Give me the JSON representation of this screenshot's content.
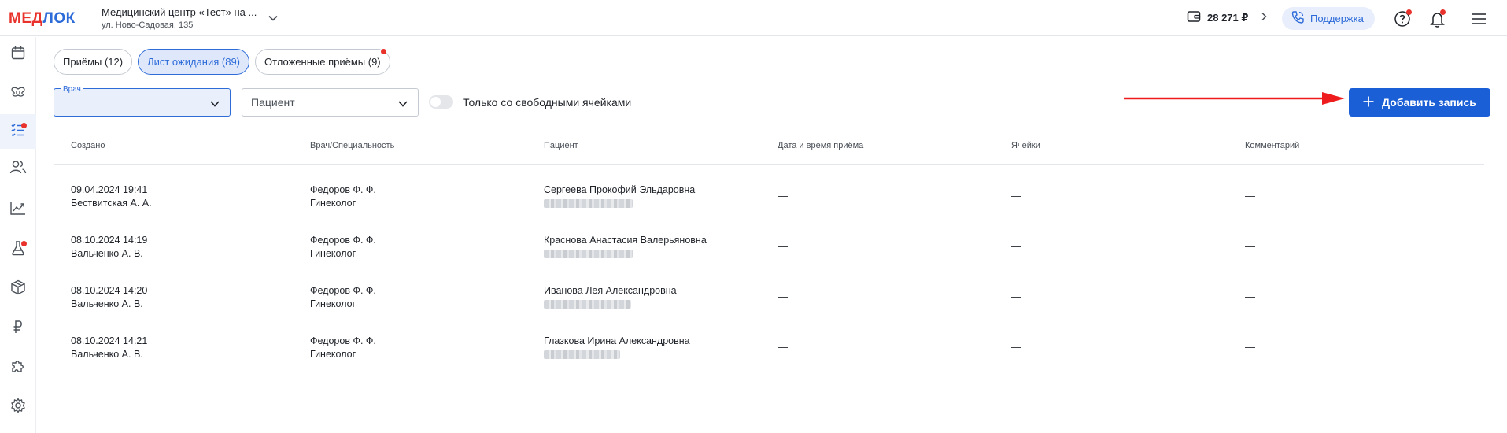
{
  "brand": {
    "part1": "МЕД",
    "part2": "ЛОК"
  },
  "clinic": {
    "name": "Медицинский центр «Тест» на ...",
    "address": "ул. Ново-Садовая, 135"
  },
  "header": {
    "balance": "28 271 ₽",
    "support_label": "Поддержка"
  },
  "sidebar": {
    "items": [
      {
        "name": "calendar-icon",
        "active": false,
        "badge": false
      },
      {
        "name": "dental-icon",
        "active": false,
        "badge": false
      },
      {
        "name": "checklist-icon",
        "active": true,
        "badge": true
      },
      {
        "name": "users-icon",
        "active": false,
        "badge": false
      },
      {
        "name": "analytics-icon",
        "active": false,
        "badge": false
      },
      {
        "name": "lab-flask-icon",
        "active": false,
        "badge": true
      },
      {
        "name": "box-icon",
        "active": false,
        "badge": false
      },
      {
        "name": "ruble-icon",
        "active": false,
        "badge": false
      },
      {
        "name": "puzzle-icon",
        "active": false,
        "badge": false
      },
      {
        "name": "settings-icon",
        "active": false,
        "badge": false
      }
    ]
  },
  "tabs": [
    {
      "label": "Приёмы (12)",
      "active": false
    },
    {
      "label": "Лист ожидания (89)",
      "active": true
    },
    {
      "label": "Отложенные приёмы (9)",
      "active": false
    }
  ],
  "filters": {
    "doctor_label": "Врач",
    "doctor_value": "",
    "patient_placeholder": "Пациент",
    "toggle_label": "Только со свободными ячейками"
  },
  "add_button": "Добавить запись",
  "table": {
    "columns": [
      "Создано",
      "Врач/Специальность",
      "Пациент",
      "Дата и время приёма",
      "Ячейки",
      "Комментарий"
    ],
    "rows": [
      {
        "created": "09.04.2024 19:41",
        "author": "Бествитская А. А.",
        "doctor": "Федоров Ф. Ф.",
        "specialty": "Гинеколог",
        "patient": "Сергеева Прокофий Эльдаровна",
        "date": "—",
        "cells": "—",
        "comment": "—"
      },
      {
        "created": "08.10.2024 14:19",
        "author": "Вальченко А. В.",
        "doctor": "Федоров Ф. Ф.",
        "specialty": "Гинеколог",
        "patient": "Краснова Анастасия Валерьяновна",
        "date": "—",
        "cells": "—",
        "comment": "—"
      },
      {
        "created": "08.10.2024 14:20",
        "author": "Вальченко А. В.",
        "doctor": "Федоров Ф. Ф.",
        "specialty": "Гинеколог",
        "patient": "Иванова Лея Александровна",
        "date": "—",
        "cells": "—",
        "comment": "—"
      },
      {
        "created": "08.10.2024 14:21",
        "author": "Вальченко А. В.",
        "doctor": "Федоров Ф. Ф.",
        "specialty": "Гинеколог",
        "patient": "Глазкова Ирина Александровна",
        "date": "—",
        "cells": "—",
        "comment": "—"
      }
    ]
  },
  "colors": {
    "accent": "#2d6bd9",
    "brand_red": "#e8322b",
    "button": "#1b5fd6",
    "badge": "#e8322b"
  }
}
